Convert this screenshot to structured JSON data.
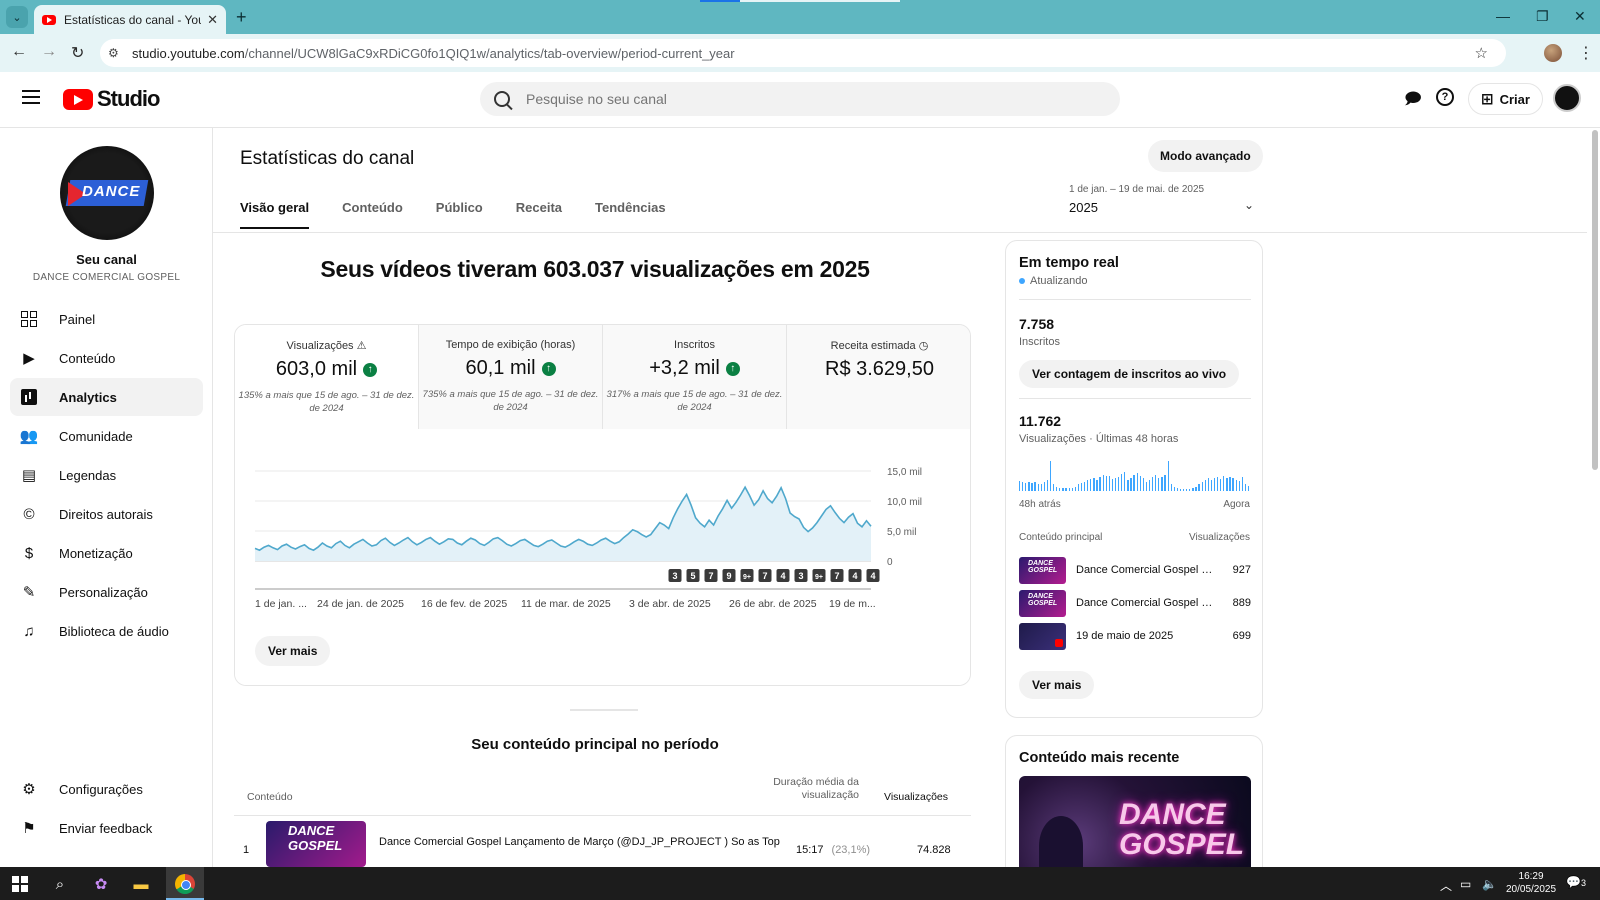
{
  "browser": {
    "tab_title": "Estatísticas do canal - YouTube",
    "url_domain": "studio.youtube.com",
    "url_path": "/channel/UCW8lGaC9xRDiCG0fo1QIQ1w/analytics/tab-overview/period-current_year"
  },
  "header": {
    "logo_text": "Studio",
    "search_placeholder": "Pesquise no seu canal",
    "create_label": "Criar"
  },
  "sidebar": {
    "channel_name": "Seu canal",
    "channel_handle": "DANCE COMERCIAL GOSPEL",
    "avatar_text": "DANCE",
    "items": [
      {
        "label": "Painel"
      },
      {
        "label": "Conteúdo"
      },
      {
        "label": "Analytics"
      },
      {
        "label": "Comunidade"
      },
      {
        "label": "Legendas"
      },
      {
        "label": "Direitos autorais"
      },
      {
        "label": "Monetização"
      },
      {
        "label": "Personalização"
      },
      {
        "label": "Biblioteca de áudio"
      }
    ],
    "bottom": [
      {
        "label": "Configurações"
      },
      {
        "label": "Enviar feedback"
      }
    ]
  },
  "main": {
    "title": "Estatísticas do canal",
    "advanced_mode": "Modo avançado",
    "tabs": [
      {
        "label": "Visão geral"
      },
      {
        "label": "Conteúdo"
      },
      {
        "label": "Público"
      },
      {
        "label": "Receita"
      },
      {
        "label": "Tendências"
      }
    ],
    "range_sub": "1 de jan. – 19 de mai. de 2025",
    "range_main": "2025",
    "headline": "Seus vídeos tiveram 603.037 visualizações em 2025",
    "metrics": [
      {
        "label": "Visualizações",
        "value": "603,0 mil",
        "delta": "135% a mais que 15 de ago. – 31 de dez. de 2024"
      },
      {
        "label": "Tempo de exibição (horas)",
        "value": "60,1 mil",
        "delta": "735% a mais que 15 de ago. – 31 de dez. de 2024"
      },
      {
        "label": "Inscritos",
        "value": "+3,2 mil",
        "delta": "317% a mais que 15 de ago. – 31 de dez. de 2024"
      },
      {
        "label": "Receita estimada",
        "value": "R$ 3.629,50",
        "delta": ""
      }
    ],
    "see_more": "Ver mais",
    "top_content": {
      "title": "Seu conteúdo principal no período",
      "col_content": "Conteúdo",
      "col_duration_1": "Duração média da",
      "col_duration_2": "visualização",
      "col_views": "Visualizações",
      "rows": [
        {
          "rank": "1",
          "thumb_text": "DANCE GOSPEL",
          "title": "Dance Comercial Gospel Lançamento de Março (@DJ_JP_PROJECT ) So as Top",
          "duration": "15:17",
          "duration_pct": "(23,1%)",
          "views": "74.828"
        }
      ]
    }
  },
  "chart_data": {
    "type": "area",
    "title": "",
    "y_ticks": [
      "0",
      "5,0 mil",
      "10,0 mil",
      "15,0 mil"
    ],
    "ylim": [
      0,
      15000
    ],
    "x_tick_labels": [
      "1 de jan. ...",
      "24 de jan. de 2025",
      "16 de fev. de 2025",
      "11 de mar. de 2025",
      "3 de abr. de 2025",
      "26 de abr. de 2025",
      "19 de m..."
    ],
    "series": [
      {
        "color": "#4fa8cc",
        "values": [
          2100,
          1800,
          2300,
          2600,
          2200,
          1900,
          2500,
          2800,
          2300,
          2000,
          2400,
          2700,
          2100,
          1800,
          2300,
          3000,
          2500,
          2200,
          2900,
          3300,
          2600,
          2200,
          2800,
          3200,
          3600,
          3000,
          2500,
          2700,
          3400,
          3800,
          3100,
          2600,
          3000,
          3500,
          3900,
          3200,
          2700,
          3100,
          3600,
          3900,
          3300,
          2800,
          3200,
          3700,
          3600,
          3000,
          2700,
          3300,
          3800,
          3500,
          2900,
          2600,
          3100,
          3700,
          3900,
          3400,
          2800,
          2500,
          2900,
          3400,
          3600,
          3100,
          2600,
          2400,
          2800,
          3300,
          3500,
          3000,
          2500,
          2300,
          2700,
          3200,
          3600,
          3300,
          2800,
          2600,
          3000,
          3500,
          3800,
          3300,
          2900,
          3200,
          3900,
          4500,
          5200,
          4900,
          4400,
          4000,
          4400,
          5400,
          6400,
          6000,
          5400,
          7200,
          8700,
          10000,
          11100,
          9300,
          7200,
          6300,
          5700,
          6800,
          6000,
          7500,
          8700,
          10100,
          8800,
          9800,
          11000,
          12300,
          10900,
          9300,
          10200,
          11700,
          10400,
          9700,
          10800,
          12200,
          10400,
          8000,
          7400,
          7000,
          5600,
          4900,
          5500,
          6400,
          7500,
          8600,
          9200,
          8100,
          7100,
          6400,
          7300,
          7900,
          6300,
          5700,
          6700,
          5800
        ]
      }
    ],
    "markers": [
      "3",
      "5",
      "7",
      "9",
      "9+",
      "7",
      "4",
      "3",
      "9+",
      "7",
      "4",
      "4"
    ]
  },
  "realtime": {
    "title": "Em tempo real",
    "status": "Atualizando",
    "subs_value": "7.758",
    "subs_label": "Inscritos",
    "live_count_btn": "Ver contagem de inscritos ao vivo",
    "views_value": "11.762",
    "views_label": "Visualizações · Últimas 48 horas",
    "bars": [
      0.35,
      0.3,
      0.28,
      0.3,
      0.26,
      0.3,
      0.22,
      0.22,
      0.3,
      0.38,
      1.0,
      0.22,
      0.12,
      0.1,
      0.1,
      0.1,
      0.1,
      0.1,
      0.15,
      0.22,
      0.26,
      0.3,
      0.36,
      0.4,
      0.45,
      0.38,
      0.48,
      0.55,
      0.5,
      0.5,
      0.4,
      0.45,
      0.48,
      0.56,
      0.62,
      0.38,
      0.42,
      0.55,
      0.6,
      0.5,
      0.42,
      0.3,
      0.38,
      0.48,
      0.55,
      0.42,
      0.48,
      0.52,
      1.0,
      0.22,
      0.12,
      0.1,
      0.08,
      0.06,
      0.06,
      0.08,
      0.1,
      0.15,
      0.22,
      0.3,
      0.36,
      0.45,
      0.38,
      0.42,
      0.46,
      0.4,
      0.5,
      0.42,
      0.48,
      0.44,
      0.38,
      0.32,
      0.46,
      0.22,
      0.18
    ],
    "axis_left": "48h atrás",
    "axis_right": "Agora",
    "top_head_left": "Conteúdo principal",
    "top_head_right": "Visualizações",
    "top_items": [
      {
        "name": "Dance Comercial Gospel 2...",
        "views": "927",
        "thumb_text": "DANCE GOSPEL"
      },
      {
        "name": "Dance Comercial Gospel L...",
        "views": "889",
        "thumb_text": "DANCE GOSPEL"
      },
      {
        "name": "19 de maio de 2025",
        "views": "699",
        "thumb_text": ""
      }
    ],
    "see_more": "Ver mais"
  },
  "recent": {
    "title": "Conteúdo mais recente",
    "thumb_text_1": "DANCE",
    "thumb_text_2": "GOSPEL"
  },
  "taskbar": {
    "time": "16:29",
    "date": "20/05/2025",
    "notif_count": "3"
  }
}
